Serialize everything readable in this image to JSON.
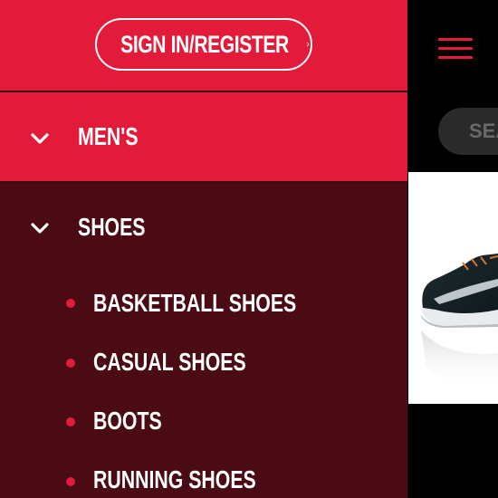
{
  "drawer": {
    "signin_label": "SIGN IN/REGISTER",
    "sections": {
      "mens": {
        "label": "MEN'S"
      },
      "shoes": {
        "label": "SHOES"
      }
    },
    "sub_items": [
      {
        "label": "BASKETBALL SHOES"
      },
      {
        "label": "CASUAL SHOES"
      },
      {
        "label": "BOOTS"
      },
      {
        "label": "RUNNING SHOES"
      }
    ]
  },
  "background": {
    "search_placeholder": "SEARCH"
  },
  "colors": {
    "accent": "#e31b3a",
    "drawer_body": "#4a0b14",
    "page_bg": "#000000"
  }
}
